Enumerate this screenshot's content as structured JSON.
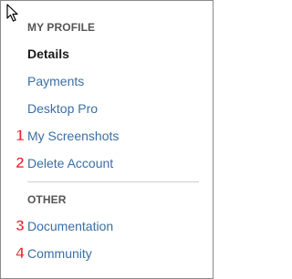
{
  "sections": {
    "profile": {
      "header": "MY PROFILE",
      "items": [
        {
          "label": "Details",
          "active": true
        },
        {
          "label": "Payments"
        },
        {
          "label": "Desktop Pro"
        },
        {
          "label": "My Screenshots",
          "badge": "1"
        },
        {
          "label": "Delete Account",
          "badge": "2"
        }
      ]
    },
    "other": {
      "header": "OTHER",
      "items": [
        {
          "label": "Documentation",
          "badge": "3"
        },
        {
          "label": "Community",
          "badge": "4"
        }
      ]
    }
  },
  "colors": {
    "link": "#3a6ea5",
    "active": "#1a1a1a",
    "header": "#555555",
    "badge": "#e8202a",
    "divider": "#d0d0d0"
  },
  "icons": {
    "cursor": "mouse-pointer-icon"
  }
}
